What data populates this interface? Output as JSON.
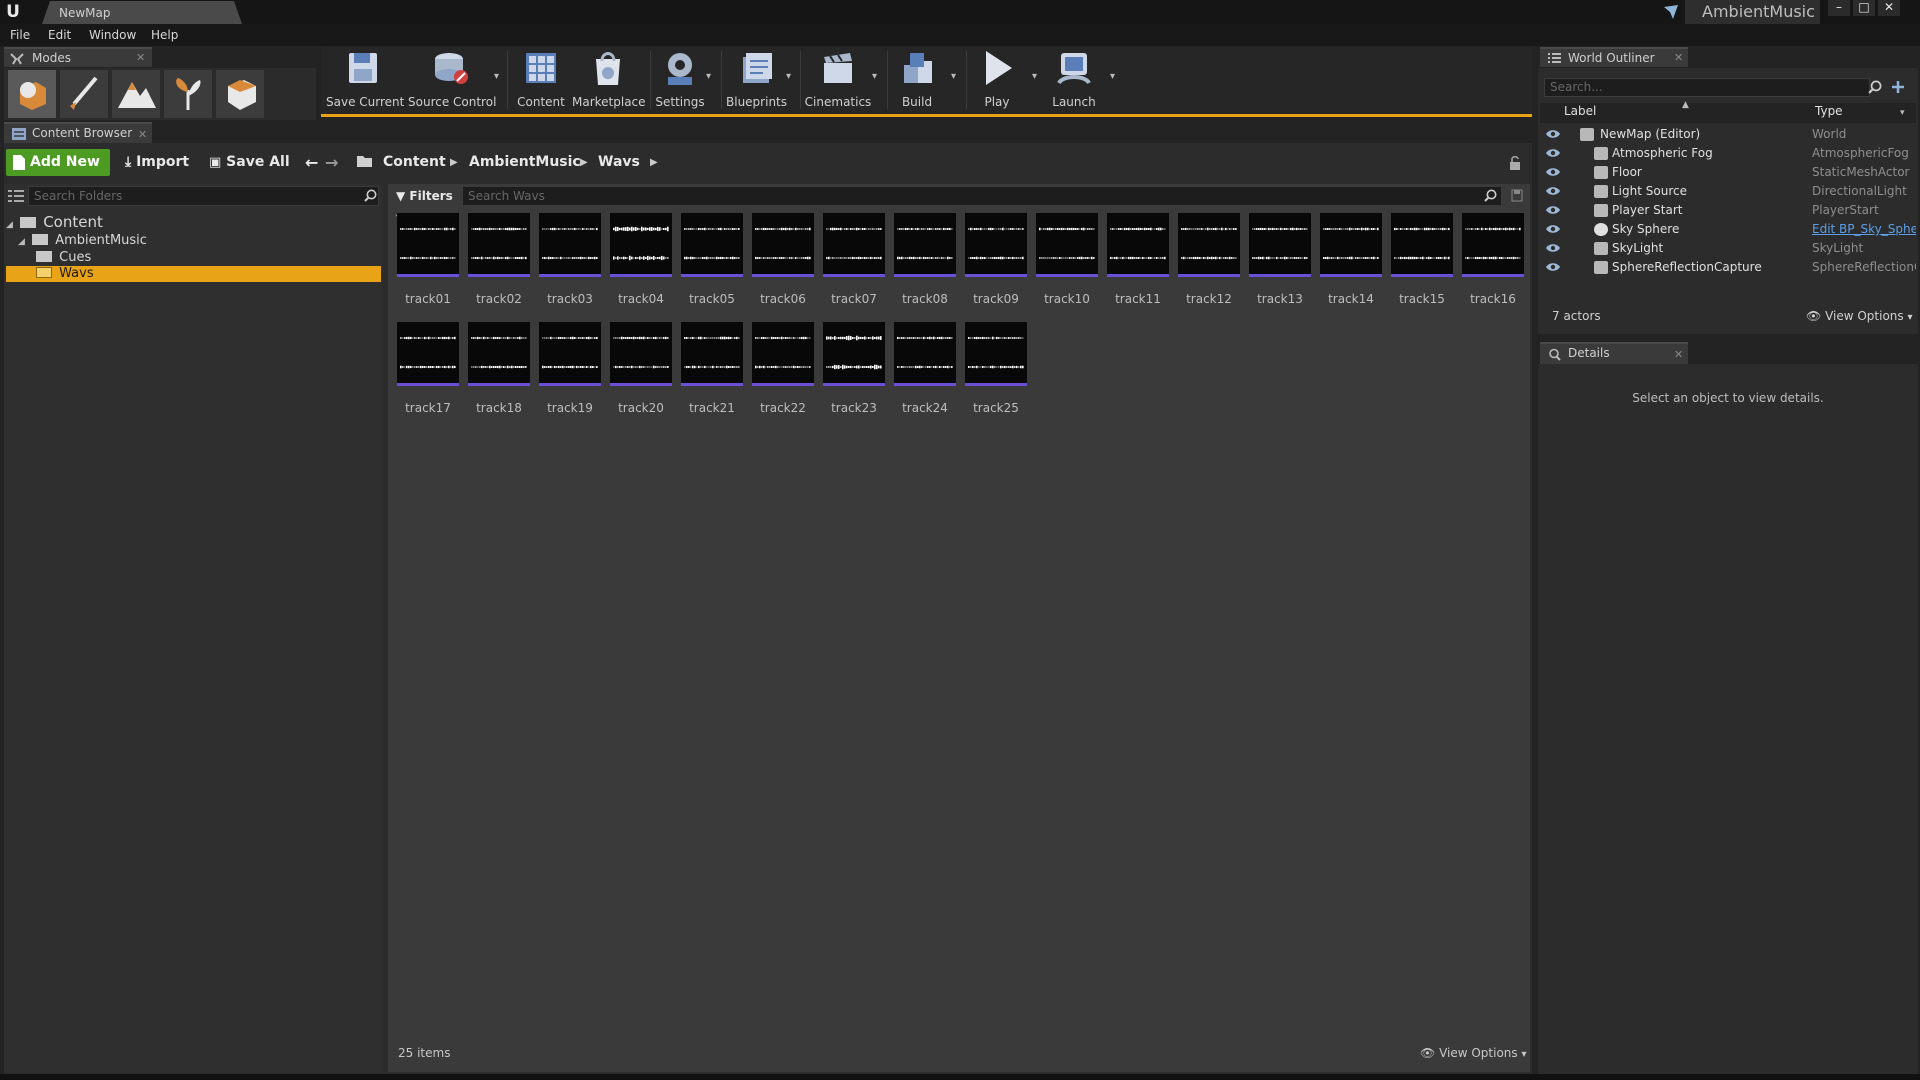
{
  "window": {
    "map_tab": "NewMap",
    "project_name": "AmbientMusic",
    "controls": {
      "minimize": "–",
      "maximize": "□",
      "close": "✕"
    }
  },
  "menu": {
    "items": [
      "File",
      "Edit",
      "Window",
      "Help"
    ]
  },
  "modes": {
    "tab_label": "Modes",
    "buttons": [
      "place-mode",
      "paint-mode",
      "landscape-mode",
      "foliage-mode",
      "geometry-mode"
    ]
  },
  "toolbar": {
    "buttons": [
      {
        "label": "Save Current",
        "icon": "save-icon",
        "dropdown": false
      },
      {
        "label": "Source Control",
        "icon": "source-control-icon",
        "dropdown": true
      },
      {
        "label": "Content",
        "icon": "content-icon",
        "dropdown": false
      },
      {
        "label": "Marketplace",
        "icon": "marketplace-icon",
        "dropdown": false
      },
      {
        "label": "Settings",
        "icon": "settings-icon",
        "dropdown": true
      },
      {
        "label": "Blueprints",
        "icon": "blueprints-icon",
        "dropdown": true
      },
      {
        "label": "Cinematics",
        "icon": "cinematics-icon",
        "dropdown": true
      },
      {
        "label": "Build",
        "icon": "build-icon",
        "dropdown": true
      },
      {
        "label": "Play",
        "icon": "play-icon",
        "dropdown": true
      },
      {
        "label": "Launch",
        "icon": "launch-icon",
        "dropdown": true
      }
    ]
  },
  "content_browser": {
    "tab_label": "Content Browser",
    "add_new": "Add New",
    "import": "Import",
    "save_all": "Save All",
    "breadcrumb": [
      "Content",
      "AmbientMusic",
      "Wavs"
    ],
    "folder_search_placeholder": "Search Folders",
    "filters": "Filters",
    "asset_search_placeholder": "Search Wavs",
    "tree": [
      {
        "label": "Content",
        "depth": 0,
        "selected": false
      },
      {
        "label": "AmbientMusic",
        "depth": 1,
        "selected": false
      },
      {
        "label": "Cues",
        "depth": 2,
        "selected": false
      },
      {
        "label": "Wavs",
        "depth": 2,
        "selected": true
      }
    ],
    "assets": [
      "track01",
      "track02",
      "track03",
      "track04",
      "track05",
      "track06",
      "track07",
      "track08",
      "track09",
      "track10",
      "track11",
      "track12",
      "track13",
      "track14",
      "track15",
      "track16",
      "track17",
      "track18",
      "track19",
      "track20",
      "track21",
      "track22",
      "track23",
      "track24",
      "track25"
    ],
    "items_count": "25 items",
    "view_options": "View Options"
  },
  "world_outliner": {
    "tab_label": "World Outliner",
    "search_placeholder": "Search...",
    "columns": {
      "label": "Label",
      "type": "Type"
    },
    "rows": [
      {
        "label": "NewMap (Editor)",
        "type": "World",
        "icon": "world-icon",
        "link": false
      },
      {
        "label": "Atmospheric Fog",
        "type": "AtmosphericFog",
        "icon": "fog-icon",
        "link": false
      },
      {
        "label": "Floor",
        "type": "StaticMeshActor",
        "icon": "static-mesh-icon",
        "link": false
      },
      {
        "label": "Light Source",
        "type": "DirectionalLight",
        "icon": "directional-light-icon",
        "link": false
      },
      {
        "label": "Player Start",
        "type": "PlayerStart",
        "icon": "player-start-icon",
        "link": false
      },
      {
        "label": "Sky Sphere",
        "type": "Edit BP_Sky_Sphere",
        "icon": "sphere-icon",
        "link": true
      },
      {
        "label": "SkyLight",
        "type": "SkyLight",
        "icon": "skylight-icon",
        "link": false
      },
      {
        "label": "SphereReflectionCapture",
        "type": "SphereReflectionCapture",
        "icon": "reflection-capture-icon",
        "link": false
      }
    ],
    "actors_count": "7 actors",
    "view_options": "View Options"
  },
  "details": {
    "tab_label": "Details",
    "empty_message": "Select an object to view details."
  },
  "colors": {
    "accent": "#e8a317",
    "add_new": "#4e9b24",
    "tile_strip": "#6b4fd6",
    "link": "#5a9fe8"
  }
}
